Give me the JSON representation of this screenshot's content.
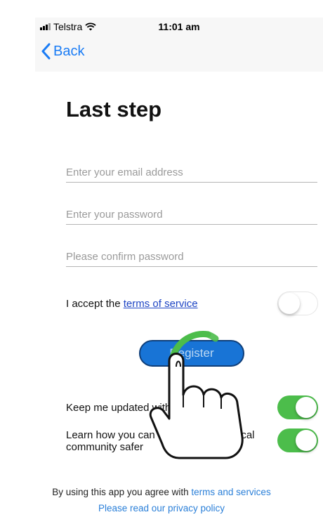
{
  "status_bar": {
    "carrier": "Telstra",
    "time": "11:01 am"
  },
  "nav": {
    "back_label": "Back"
  },
  "page": {
    "title": "Last step"
  },
  "form": {
    "email_placeholder": "Enter your email address",
    "password_placeholder": "Enter your password",
    "confirm_placeholder": "Please confirm password"
  },
  "terms": {
    "prefix": "I accept the ",
    "link_label": "terms of service",
    "toggle_on": false
  },
  "register": {
    "label": "Register"
  },
  "options": [
    {
      "label": "Keep me updated with Swann",
      "toggle_on": true
    },
    {
      "label": "Learn how you can help make your local community safer",
      "toggle_on": true
    }
  ],
  "footer": {
    "agree_prefix": "By using this app you agree with ",
    "agree_link": "terms and services",
    "privacy_link": "Please read our privacy policy"
  },
  "colors": {
    "accent": "#1a7cf5",
    "toggle_on": "#4cbd4b",
    "register_bg": "#1874d6",
    "footer_link": "#2a7fd8"
  },
  "icons": [
    "signal-icon",
    "wifi-icon",
    "chevron-left-icon",
    "tap-gesture-hand-icon"
  ]
}
